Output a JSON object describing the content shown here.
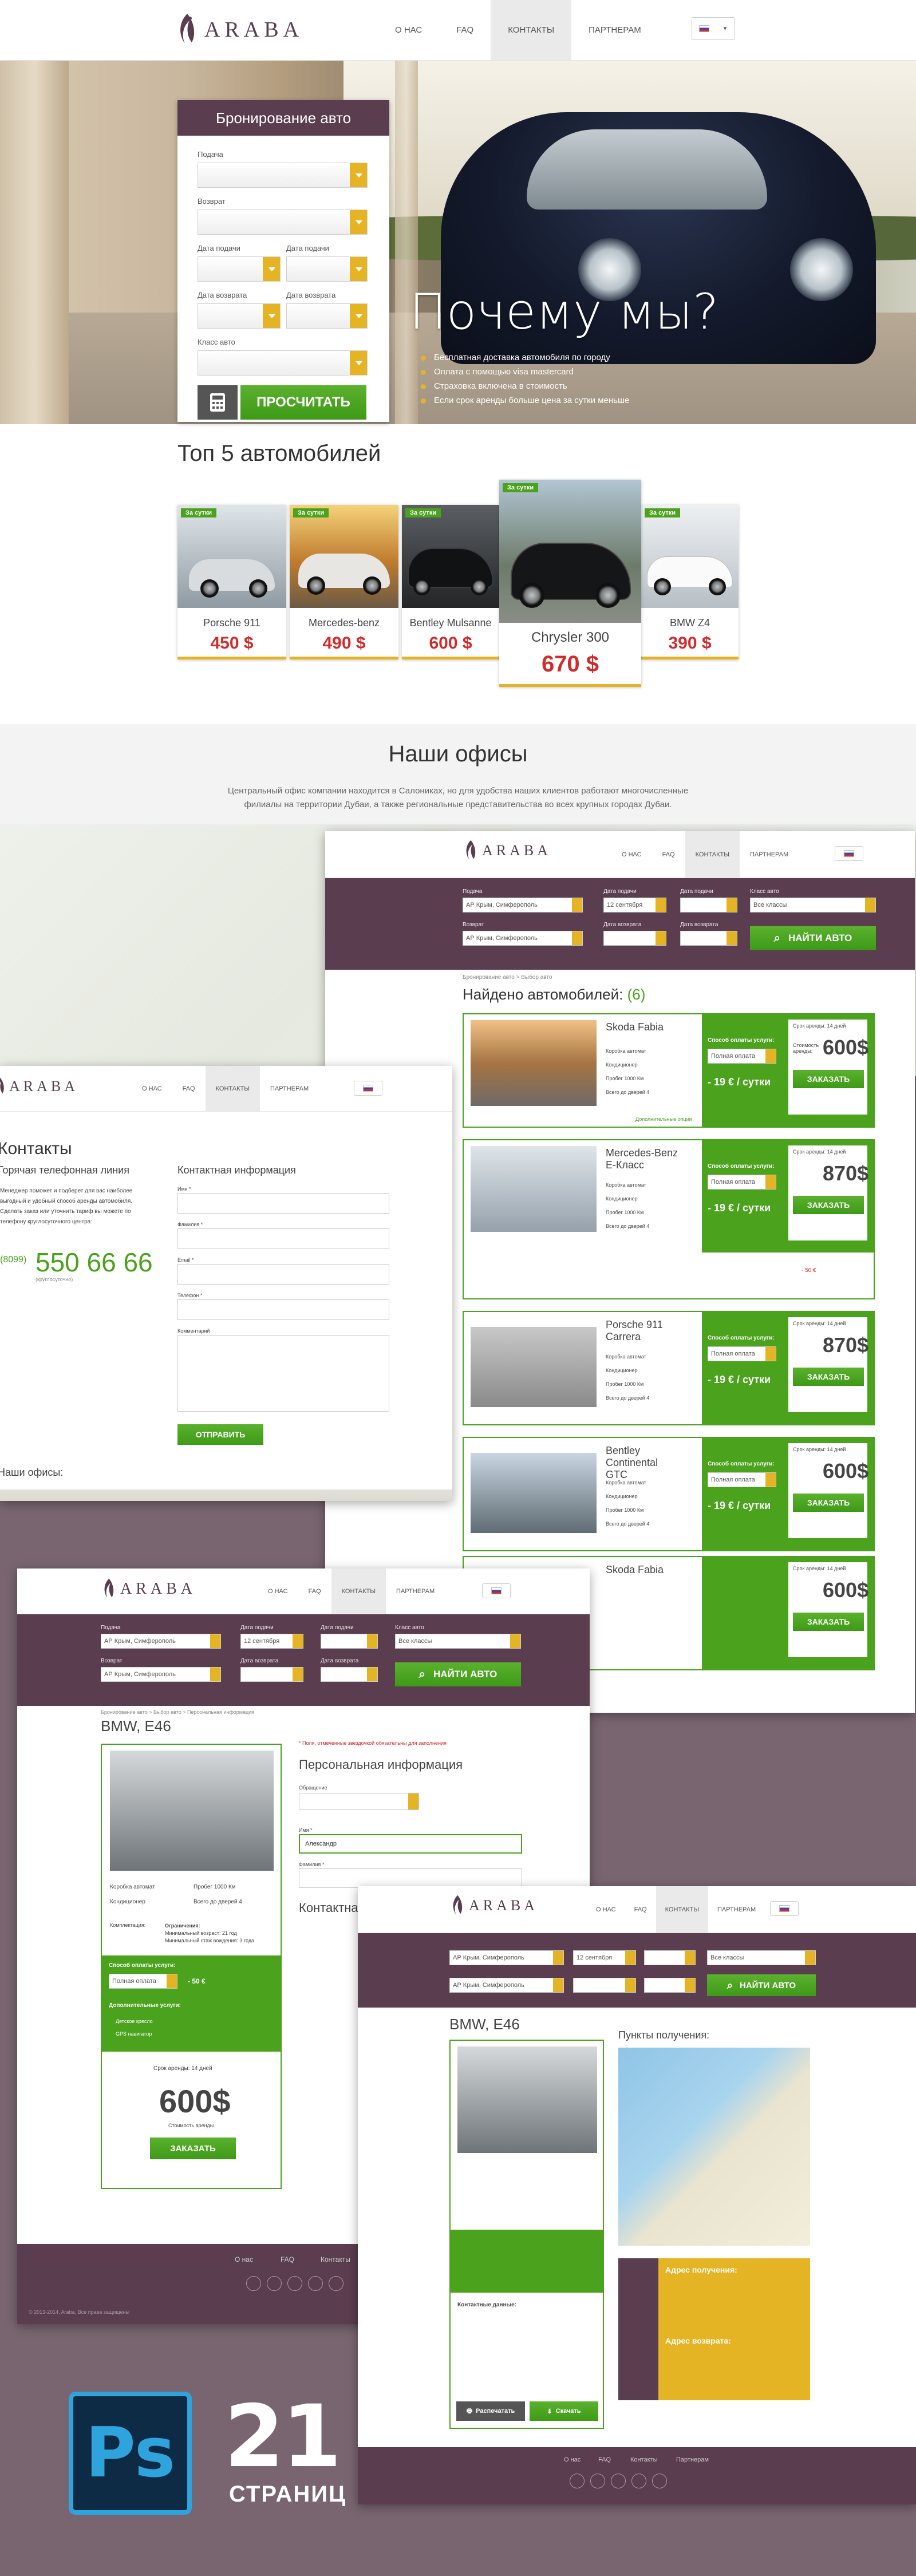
{
  "header": {
    "logo": "ARABA",
    "nav": [
      "О НАС",
      "FAQ",
      "КОНТАКТЫ",
      "ПАРТНЕРАМ"
    ],
    "active_nav": "КОНТАКТЫ"
  },
  "booking": {
    "title": "Бронирование авто",
    "pickup_label": "Подача",
    "return_label": "Возврат",
    "pickup_date_label": "Дата подачи",
    "return_date_label": "Дата возврата",
    "class_label": "Класс авто",
    "calc_button": "ПРОСЧИТАТЬ"
  },
  "why": {
    "title": "Почему мы?",
    "items": [
      "Бесплатная доставка автомобиля по городу",
      "Оплата с помощью visa mastercard",
      "Страховка включена в стоимость",
      "Если срок аренды больше цена за сутки меньше"
    ]
  },
  "top5": {
    "title": "Топ 5 автомобилей",
    "tag": "За сутки",
    "cars": [
      {
        "name": "Porsche 911",
        "price": "450 $"
      },
      {
        "name": "Mercedes-benz",
        "price": "490 $"
      },
      {
        "name": "Bentley Mulsanne",
        "price": "600 $"
      },
      {
        "name": "Chrysler 300",
        "price": "670 $"
      },
      {
        "name": "BMW Z4",
        "price": "390 $"
      }
    ]
  },
  "offices": {
    "title": "Наши офисы",
    "text": "Центральный офис компании находится в Салониках, но для удобства наших клиентов работают многочисленные филиалы на территории Дубаи, а также региональные представительства во всех крупных городах Дубаи."
  },
  "search_pane": {
    "labels": [
      "Подача",
      "Дата подачи",
      "Дата подачи",
      "Класс авто",
      "Возврат",
      "Дата возврата",
      "Дата возврата"
    ],
    "pickup_value": "АР Крым, Симферополь",
    "date_value": "12 сентября",
    "class_value": "Все классы",
    "find_button": "НАЙТИ АВТО",
    "breadcrumb": "Бронирование авто  >  Выбор авто",
    "found": "Найдено автомобилей:",
    "found_count": "(6)",
    "results": [
      {
        "name": "Skoda Fabia",
        "price": "600$"
      },
      {
        "name": "Mercedes-Benz E-Класс",
        "price": "870$"
      },
      {
        "name": "Porsche 911 Carrera",
        "price": "870$"
      },
      {
        "name": "Bentley Continental GTC",
        "price": "600$"
      },
      {
        "name": "Skoda Fabia",
        "price": "600$"
      }
    ],
    "features": [
      "Коробка автомат",
      "Кондиционер",
      "Пробег 1000 Км",
      "Всего до дверей 4"
    ],
    "payment_label": "Способ оплаты услуги:",
    "payment_value": "Полная оплата",
    "per_day": "- 19 € / сутки",
    "term": "Срок аренды: 14 дней",
    "cost_label": "Стоимость аренды:",
    "order": "ЗАКАЗАТЬ",
    "extra": "Дополнительные опции",
    "price_sm": "- 50 €"
  },
  "contacts_pane": {
    "title": "Контакты",
    "hotline": "Горячая телефонная линия",
    "hotline_text": "Менеджер поможет и подберет для вас наиболее выгодный и удобный способ аренды автомобиля. Сделать заказ или уточнить тариф вы можете по телефону круглосуточного центра:",
    "prefix": "(8099)",
    "phone": "550 66 66",
    "phone_note": "(круглосуточно)",
    "info": "Контактная информация",
    "fields": [
      "Имя *",
      "Фамилия *",
      "Email *",
      "Телефон *",
      "Комментарий"
    ],
    "send": "ОТПРАВИТЬ",
    "offices": "Наши офисы:"
  },
  "detail_pane": {
    "breadcrumb": "Бронирование авто  >  Выбор авто  >  Персональная информация",
    "car": "BMW, E46",
    "required": "* Поля, отмеченные звездочкой обязательны для заполнения",
    "personal": "Персональная информация",
    "field_labels": [
      "Обращение",
      "Имя *",
      "Фамилия *"
    ],
    "name_value": "Александр",
    "contact": "Контактная",
    "equipment": "Комплектация:",
    "restrictions": "Ограничения:",
    "equip_items": [
      "Коробка автомат",
      "Кондиционер",
      "Пробег 1000 Км",
      "Всего до дверей 4"
    ],
    "restrict_items": [
      "Минимальный возраст: 21 год",
      "Минимальный стаж вождения: 3 года"
    ],
    "payment_label": "Способ оплаты услуги:",
    "payment_value": "Полная оплата",
    "price_sm": "- 50 €",
    "extras": "Дополнительные услуги:",
    "extra_items": [
      "Детское кресло",
      "GPS навигатор"
    ],
    "term": "Срок аренды: 14 дней",
    "price": "600$",
    "cost_label": "Стоимость аренды",
    "order": "ЗАКАЗАТЬ",
    "footer_links": [
      "О нас",
      "FAQ",
      "Контакты"
    ],
    "copyright": "© 2013-2014, Araba, Все права защищены"
  },
  "pickup_pane": {
    "car": "BMW, E46",
    "points": "Пункты получения:",
    "pickup_addr": "Адрес получения:",
    "return_addr": "Адрес возврата:",
    "contacts": "Контактные данные:",
    "print": "Распечатать",
    "save": "Скачать",
    "footer_links": [
      "О нас",
      "FAQ",
      "Контакты",
      "Партнерам"
    ]
  },
  "badge": {
    "app": "Ps",
    "count": "21",
    "label": "СТРАНИЦ"
  },
  "colors": {
    "brand": "#5a3d4e",
    "green": "#4aa21d",
    "yellow": "#e4b424",
    "red": "#d32b2b"
  }
}
